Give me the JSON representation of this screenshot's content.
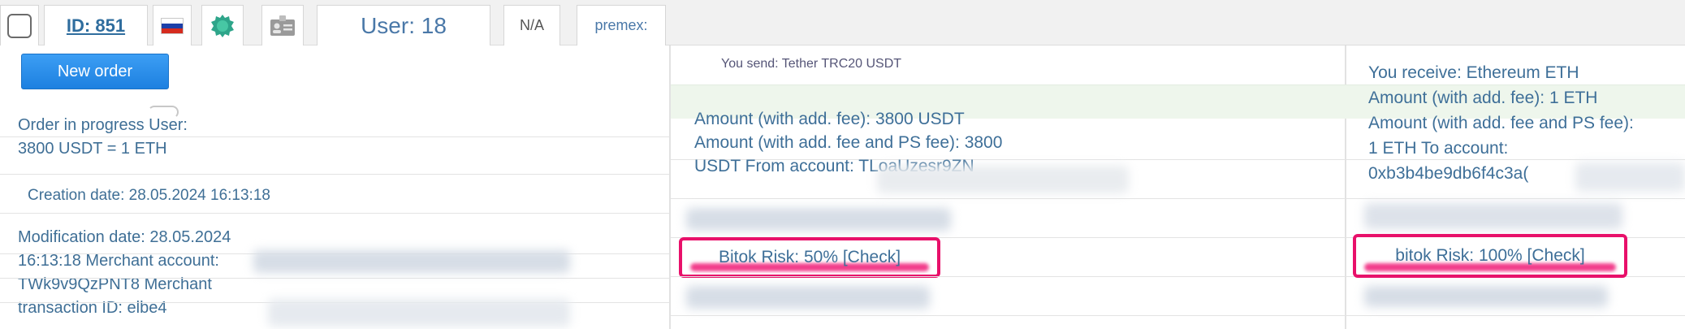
{
  "header": {
    "id_label": "ID: 851",
    "user_label": "User: 18",
    "na_label": "N/A",
    "premex_label": "premex:"
  },
  "icons": {
    "flag": "russia-flag-icon",
    "badge": "new-badge-icon",
    "card": "id-card-icon"
  },
  "order": {
    "new_order_label": "New order",
    "status_text": "Order in progress User:\n3800 USDT = 1 ETH",
    "creation_date": "Creation date: 28.05.2024 16:13:18",
    "details_text": "Modification date: 28.05.2024\n16:13:18 Merchant account:\nTWk9v9QzPNT8 Merchant\ntransaction ID: elbe4"
  },
  "send": {
    "title": "You send: Tether TRC20 USDT",
    "amount_text": "Amount (with add. fee): 3800 USDT\nAmount (with add. fee and PS fee): 3800\nUSDT From account: TLoaUzesr9ZN",
    "risk_text": "Bitok Risk: 50% [Check]"
  },
  "receive": {
    "text": "You receive: Ethereum ETH\nAmount (with add. fee): 1 ETH\nAmount (with add. fee and PS fee):\n1 ETH To account:\n0xb3b4be9db6f4c3a(",
    "risk_text": "bitok Risk: 100% [Check]"
  },
  "colors": {
    "accent": "#1d80e0",
    "text": "#3e6f98",
    "highlight": "#e8106a",
    "band": "#eef6ec"
  }
}
